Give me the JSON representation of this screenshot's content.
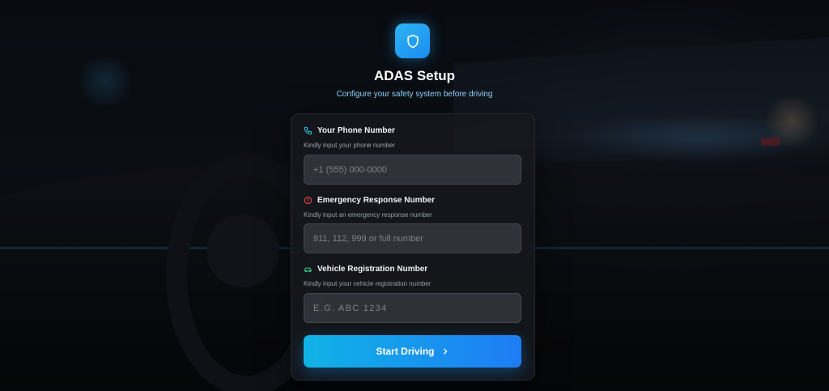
{
  "header": {
    "logo_icon": "shield-icon",
    "title": "ADAS Setup",
    "subtitle": "Configure your safety system before driving"
  },
  "form": {
    "phone": {
      "icon": "phone-icon",
      "label": "Your Phone Number",
      "hint": "Kindly input your phone number",
      "placeholder": "+1 (555) 000-0000",
      "value": ""
    },
    "emergency": {
      "icon": "alert-circle-icon",
      "label": "Emergency Response Number",
      "hint": "Kindly input an emergency response number",
      "placeholder": "911, 112, 999 or full number",
      "value": ""
    },
    "vehicle": {
      "icon": "car-icon",
      "label": "Vehicle Registration Number",
      "hint": "Kindly input your vehicle registration number",
      "placeholder": "E.G. ABC 1234",
      "value": ""
    },
    "submit": {
      "label": "Start Driving",
      "icon": "chevron-right-icon"
    }
  },
  "colors": {
    "accent": "#1a8cf0",
    "subtitle": "#8fd8ff",
    "phone_icon": "#2ec5e6",
    "alert_icon": "#e5484d",
    "car_icon": "#3ecf8e",
    "button_gradient_start": "#10b3e6",
    "button_gradient_end": "#1e7cf5"
  }
}
